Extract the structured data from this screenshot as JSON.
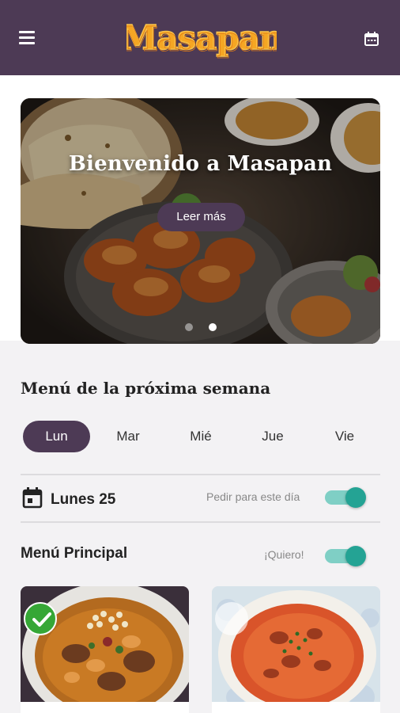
{
  "app": {
    "logo_text": "Masapan",
    "accent_color": "#4d3a55",
    "toggle_color": "#24a394"
  },
  "header": {
    "menu_icon": "hamburger-menu-icon",
    "calendar_icon": "calendar-icon"
  },
  "hero": {
    "title": "Bienvenido a Masapan",
    "button_label": "Leer más",
    "slides_total": 2,
    "active_slide": 2
  },
  "week_menu": {
    "title": "Menú de la próxima semana",
    "days": [
      "Lun",
      "Mar",
      "Mié",
      "Jue",
      "Vie"
    ],
    "selected_day": "Lun"
  },
  "selected_date": {
    "icon": "calendar-day-icon",
    "label": "Lunes 25",
    "order_label": "Pedir para este día",
    "order_enabled": true
  },
  "main_menu": {
    "title": "Menú Principal",
    "want_label": "¡Quiero!",
    "want_enabled": true,
    "dishes": [
      {
        "name": "guiso-dish",
        "selected": true
      },
      {
        "name": "rice-dish",
        "selected": false
      }
    ]
  }
}
